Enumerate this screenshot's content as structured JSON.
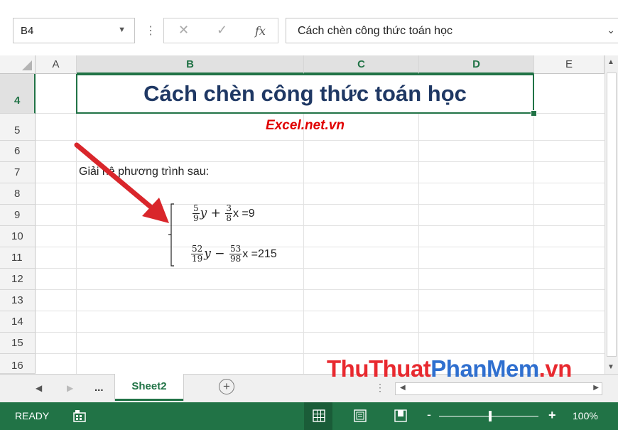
{
  "formula_bar": {
    "name_box": "B4",
    "cancel_glyph": "✕",
    "enter_glyph": "✓",
    "fx_label": "fx",
    "content": "Cách chèn công thức toán học"
  },
  "columns": [
    "A",
    "B",
    "C",
    "D",
    "E"
  ],
  "rows": [
    "4",
    "5",
    "6",
    "7",
    "8",
    "9",
    "10",
    "11",
    "12",
    "13",
    "14",
    "15",
    "16"
  ],
  "selected_cell": "B4",
  "cells": {
    "b4": "Cách chèn công thức toán học",
    "b5": "Excel.net.vn",
    "b7": "Giải hệ phương trình sau:"
  },
  "equations": [
    {
      "a_num": "5",
      "a_den": "9",
      "var1": "y",
      "op": "+",
      "b_num": "3",
      "b_den": "8",
      "rhs": "x =9"
    },
    {
      "a_num": "52",
      "a_den": "19",
      "var1": "y",
      "op": "−",
      "b_num": "53",
      "b_den": "98",
      "rhs": "x =215"
    }
  ],
  "sheets": {
    "ellipsis": "...",
    "active": "Sheet2",
    "add_glyph": "+"
  },
  "watermark": {
    "part1": "ThuThuat",
    "part2": "PhanMem",
    "part3": ".vn"
  },
  "status": {
    "mode": "READY",
    "zoom": "100%",
    "zoom_minus": "-",
    "zoom_plus": "+"
  },
  "colors": {
    "excel_green": "#217346",
    "title_navy": "#1f3864",
    "subtitle_red": "#e00000",
    "arrow_red": "#d9262b"
  }
}
